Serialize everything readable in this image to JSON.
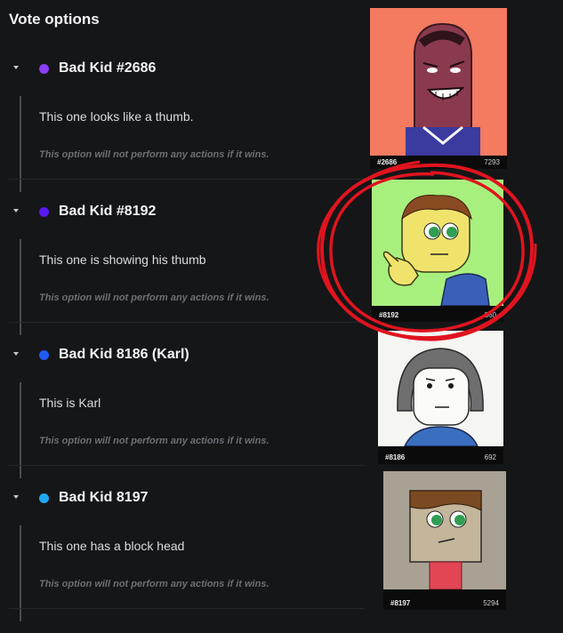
{
  "header": {
    "title": "Vote options"
  },
  "options": [
    {
      "name": "Bad Kid #2686",
      "dot_color": "#8b3cf7",
      "description": "This one looks like a thumb.",
      "note": "This option will not perform any actions if it wins.",
      "card": {
        "caption": "#2686",
        "count": "7293",
        "background": "#f47a60"
      }
    },
    {
      "name": "Bad Kid #8192",
      "dot_color": "#5a19f0",
      "description": "This one is showing his thumb",
      "note": "This option will not perform any actions if it wins.",
      "card": {
        "caption": "#8192",
        "count": "360",
        "background": "#a8f07e"
      }
    },
    {
      "name": "Bad Kid 8186 (Karl)",
      "dot_color": "#1e5cf5",
      "description": "This is Karl",
      "note": "This option will not perform any actions if it wins.",
      "card": {
        "caption": "#8186",
        "count": "692",
        "background": "#f5f5f2"
      }
    },
    {
      "name": "Bad Kid 8197",
      "dot_color": "#1eaaf0",
      "description": "This one has a block head",
      "note": "This option will not perform any actions if it wins.",
      "card": {
        "caption": "#8197",
        "count": "5294",
        "background": "#a9a294"
      }
    }
  ],
  "icons": {
    "chevron": "chevron-down-icon",
    "stats": "bar-chart-icon"
  }
}
